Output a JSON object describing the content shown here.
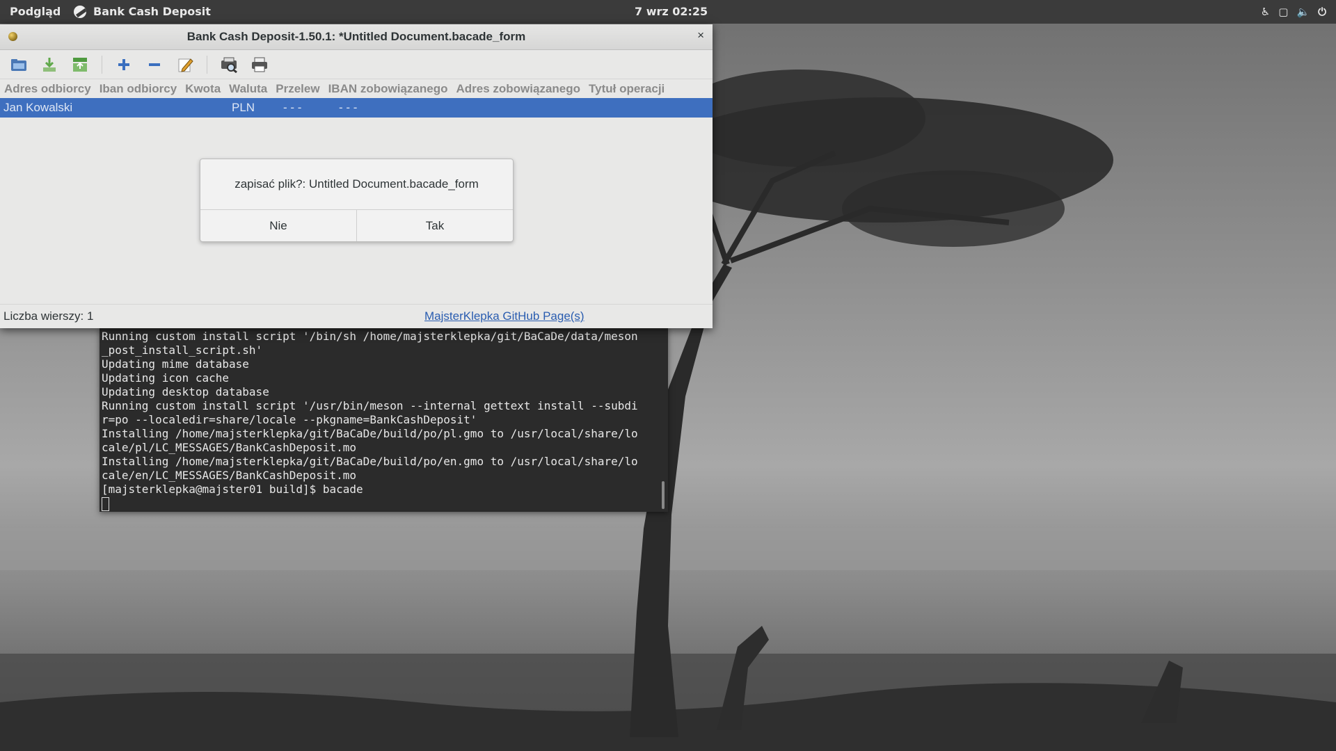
{
  "top_panel": {
    "activities": "Podgląd",
    "app_name": "Bank Cash Deposit",
    "clock": "7 wrz  02:25",
    "tray_icons": [
      "accessibility-icon",
      "window-icon",
      "volume-icon",
      "power-icon"
    ]
  },
  "window": {
    "title": "Bank Cash Deposit-1.50.1: *Untitled Document.bacade_form",
    "close_glyph": "×"
  },
  "toolbar": {
    "icons": [
      "open-icon",
      "save-icon",
      "export-icon",
      "add-row-icon",
      "remove-row-icon",
      "edit-icon",
      "preview-icon",
      "print-icon"
    ]
  },
  "table": {
    "columns": [
      "Adres odbiorcy",
      "Iban odbiorcy",
      "Kwota",
      "Waluta",
      "Przelew",
      "IBAN zobowiązanego",
      "Adres zobowiązanego",
      "Tytuł operacji"
    ],
    "row": {
      "name": "Jan Kowalski",
      "currency": "PLN",
      "przelew": "- - -",
      "iban_zobowiazanego": "- - -"
    },
    "selection_color": "#3e6fbf"
  },
  "dialog": {
    "message": "zapisać plik?: Untitled Document.bacade_form",
    "no_label": "Nie",
    "yes_label": "Tak"
  },
  "statusbar": {
    "row_count": "Liczba wierszy: 1",
    "link": "MajsterKlepka GitHub Page(s)"
  },
  "terminal": {
    "lines": [
      "Running custom install script '/bin/sh /home/majsterklepka/git/BaCaDe/data/meson",
      "_post_install_script.sh'",
      "Updating mime database",
      "Updating icon cache",
      "Updating desktop database",
      "Running custom install script '/usr/bin/meson --internal gettext install --subdi",
      "r=po --localedir=share/locale --pkgname=BankCashDeposit'",
      "Installing /home/majsterklepka/git/BaCaDe/build/po/pl.gmo to /usr/local/share/lo",
      "cale/pl/LC_MESSAGES/BankCashDeposit.mo",
      "Installing /home/majsterklepka/git/BaCaDe/build/po/en.gmo to /usr/local/share/lo",
      "cale/en/LC_MESSAGES/BankCashDeposit.mo",
      "[majsterklepka@majster01 build]$ bacade"
    ]
  }
}
